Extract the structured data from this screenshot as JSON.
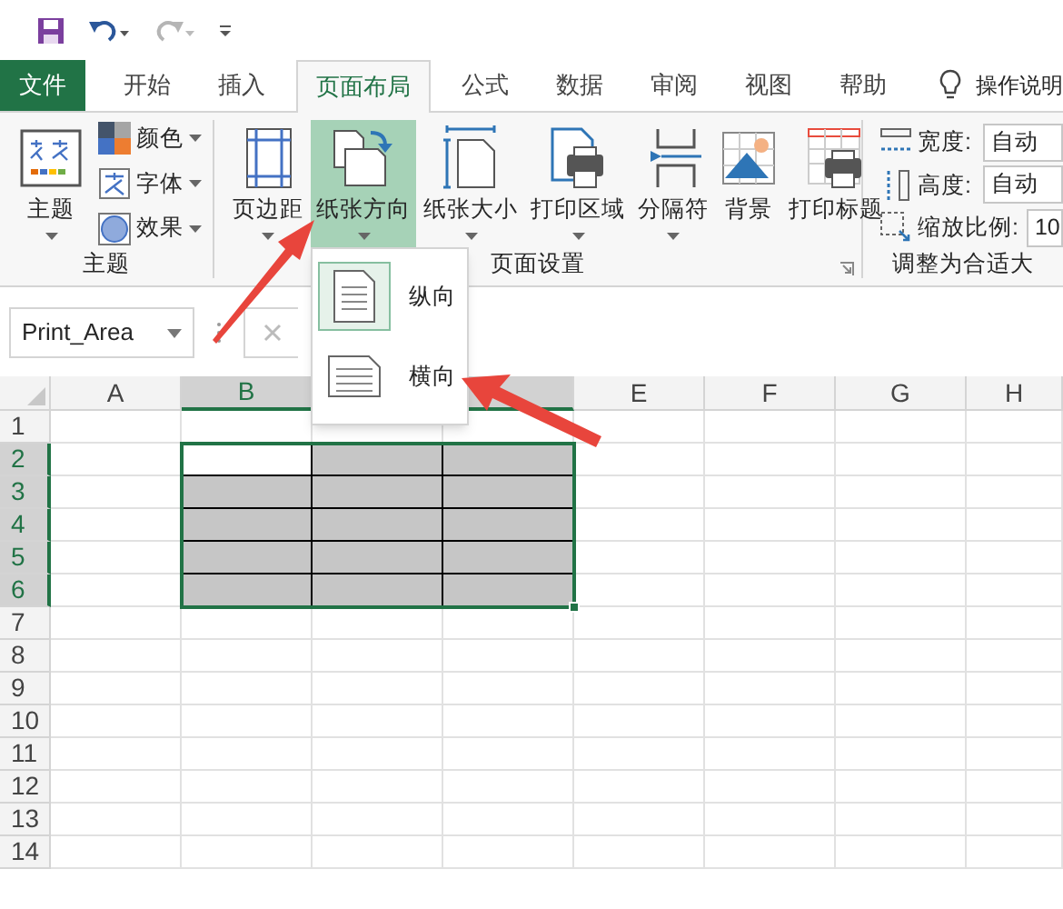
{
  "quick_access": {
    "redo_disabled": true
  },
  "tabs": [
    {
      "label": "文件",
      "kind": "file",
      "selected": false
    },
    {
      "label": "开始",
      "kind": "tab",
      "selected": false
    },
    {
      "label": "插入",
      "kind": "tab",
      "selected": false
    },
    {
      "label": "页面布局",
      "kind": "tab",
      "selected": true
    },
    {
      "label": "公式",
      "kind": "tab",
      "selected": false
    },
    {
      "label": "数据",
      "kind": "tab",
      "selected": false
    },
    {
      "label": "审阅",
      "kind": "tab",
      "selected": false
    },
    {
      "label": "视图",
      "kind": "tab",
      "selected": false
    },
    {
      "label": "帮助",
      "kind": "tab",
      "selected": false
    }
  ],
  "search_hint": "操作说明",
  "ribbon_groups": [
    {
      "label": "主题",
      "kind": "themes",
      "buttons": [
        {
          "label": "主题",
          "kind": "large",
          "selected": false
        },
        {
          "label": "颜色",
          "kind": "small"
        },
        {
          "label": "字体",
          "kind": "small"
        },
        {
          "label": "效果",
          "kind": "small"
        }
      ]
    },
    {
      "label": "页面设置",
      "kind": "page",
      "buttons": [
        {
          "label": "页边距",
          "kind": "large",
          "selected": false
        },
        {
          "label": "纸张方向",
          "kind": "large",
          "selected": true
        },
        {
          "label": "纸张大小",
          "kind": "large",
          "selected": false
        },
        {
          "label": "打印区域",
          "kind": "large",
          "selected": false
        },
        {
          "label": "分隔符",
          "kind": "large",
          "selected": false
        },
        {
          "label": "背景",
          "kind": "plain",
          "selected": false
        },
        {
          "label": "打印标题",
          "kind": "plain",
          "selected": false
        }
      ]
    },
    {
      "label": "调整为合适大",
      "kind": "scale",
      "fields": [
        {
          "label": "宽度:",
          "value": "自动"
        },
        {
          "label": "高度:",
          "value": "自动"
        },
        {
          "label": "缩放比例:",
          "value": "10"
        }
      ]
    }
  ],
  "name_box": "Print_Area",
  "orientation_menu": [
    {
      "label": "纵向",
      "selected": true
    },
    {
      "label": "横向",
      "selected": false
    }
  ],
  "sheet": {
    "columns": [
      {
        "label": "A",
        "selected": false
      },
      {
        "label": "B",
        "selected": true
      },
      {},
      {
        "selected": true
      },
      {
        "label": "E",
        "selected": false
      },
      {
        "label": "F",
        "selected": false
      },
      {
        "label": "G",
        "selected": false
      },
      {
        "label": "H",
        "selected": false
      }
    ],
    "rows": [
      {
        "header": "1",
        "selected": false
      },
      {
        "header": "2",
        "selected": true,
        "shaded": [
          false,
          false,
          true,
          true,
          false,
          false,
          false,
          false
        ],
        "bordered": [
          false,
          true,
          true,
          true,
          false,
          false,
          false,
          false
        ]
      },
      {
        "header": "3",
        "selected": true,
        "shaded": [
          false,
          true,
          true,
          true,
          false,
          false,
          false,
          false
        ],
        "bordered": [
          false,
          true,
          true,
          true,
          false,
          false,
          false,
          false
        ]
      },
      {
        "header": "4",
        "selected": true,
        "shaded": [
          false,
          true,
          true,
          true,
          false,
          false,
          false,
          false
        ],
        "bordered": [
          false,
          true,
          true,
          true,
          false,
          false,
          false,
          false
        ]
      },
      {
        "header": "5",
        "selected": true,
        "shaded": [
          false,
          true,
          true,
          true,
          false,
          false,
          false,
          false
        ],
        "bordered": [
          false,
          true,
          true,
          true,
          false,
          false,
          false,
          false
        ]
      },
      {
        "header": "6",
        "selected": true,
        "shaded": [
          false,
          true,
          true,
          true,
          false,
          false,
          false,
          false
        ],
        "bordered": [
          false,
          true,
          true,
          true,
          false,
          false,
          false,
          false
        ]
      },
      {
        "header": "7",
        "selected": false
      },
      {
        "header": "8",
        "selected": false
      },
      {
        "header": "9",
        "selected": false
      },
      {
        "header": "10",
        "selected": false
      },
      {
        "header": "11",
        "selected": false
      },
      {
        "header": "12",
        "selected": false
      },
      {
        "header": "13",
        "selected": false
      },
      {
        "header": "14",
        "selected": false
      }
    ]
  }
}
